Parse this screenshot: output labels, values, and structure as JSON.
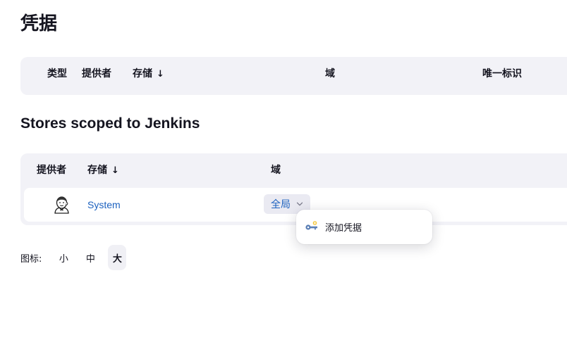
{
  "page": {
    "title": "凭据"
  },
  "credentials_table": {
    "headers": {
      "type": "类型",
      "provider": "提供者",
      "store": "存储",
      "domain": "域",
      "id": "唯一标识"
    },
    "sort_indicator": "↓"
  },
  "stores_section": {
    "title": "Stores scoped to Jenkins",
    "headers": {
      "provider": "提供者",
      "store": "存储",
      "domain": "域"
    },
    "sort_indicator": "↓",
    "rows": [
      {
        "provider_icon": "jenkins-avatar-icon",
        "store": "System",
        "domain": "全局"
      }
    ]
  },
  "dropdown": {
    "items": [
      {
        "icon": "key-icon",
        "label": "添加凭据"
      }
    ]
  },
  "icon_legend": {
    "label": "图标:",
    "options": [
      "小",
      "中",
      "大"
    ],
    "selected": "大"
  },
  "colors": {
    "link": "#1c61bf",
    "table_bg": "#f2f2f7",
    "text": "#14141f"
  }
}
